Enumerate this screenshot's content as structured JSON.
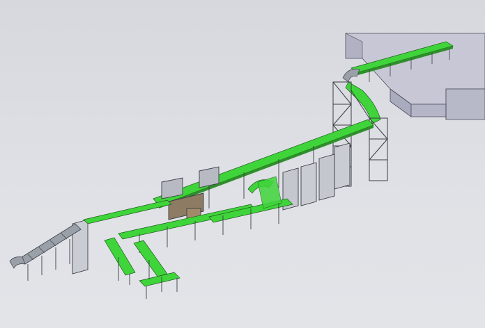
{
  "colors": {
    "background": "#dadce1",
    "belt": "#3fd53a",
    "belt_dark": "#2fa82a",
    "frame": "#3a3d44",
    "frame_light": "#8a8e96",
    "cabinet": "#c9ccd2",
    "building_top": "#c8c8d6",
    "building_side": "#aeb0c2",
    "building_front": "#b9bbcb",
    "box": "#a08a6a"
  },
  "scene": {
    "description_icon": "cad-isometric-conveyor-icon"
  }
}
